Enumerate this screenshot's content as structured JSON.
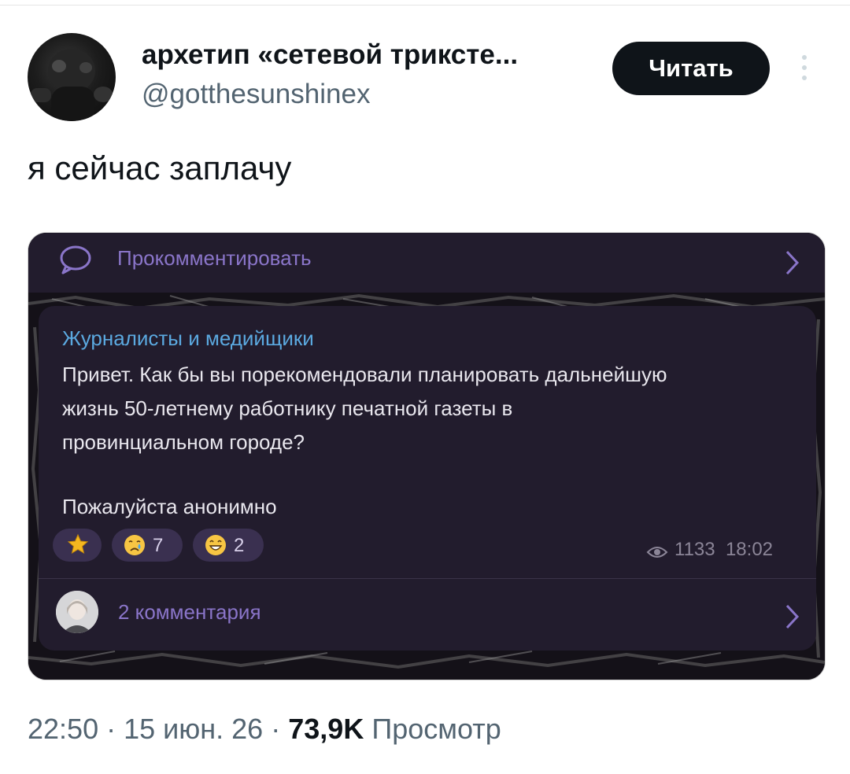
{
  "author": {
    "name": "архетип «сетевой трикстe...",
    "handle": "@gotthesunshinex"
  },
  "follow_button": {
    "label": "Читать"
  },
  "tweet": {
    "text": "я сейчас заплачу"
  },
  "embed": {
    "comment_action": "Прокомментировать",
    "channel_name": "Журналисты и медийщики",
    "message_lines": [
      "Привет. Как бы вы порекомендовали планировать дальнейшую",
      "жизнь 50-летнему работнику печатной газеты в",
      "провинциальном городе?",
      "Пожалуйста анонимно"
    ],
    "reactions": [
      {
        "emoji": "star-icon",
        "count": ""
      },
      {
        "emoji": "crying-face-icon",
        "count": "7"
      },
      {
        "emoji": "grinning-face-icon",
        "count": "2"
      }
    ],
    "views": "1133",
    "time": "18:02",
    "comments_label": "2 комментария"
  },
  "meta": {
    "time": "22:50",
    "separator": "·",
    "date": "15 июн. 26",
    "views_count": "73,9K",
    "views_label": "Просмотр"
  },
  "colors": {
    "telegram_bubble": "#221c2d",
    "telegram_accent": "#8a75c9",
    "channel_name": "#5ba9e0",
    "follow_button_bg": "#0f1419",
    "secondary_text": "#536471"
  }
}
